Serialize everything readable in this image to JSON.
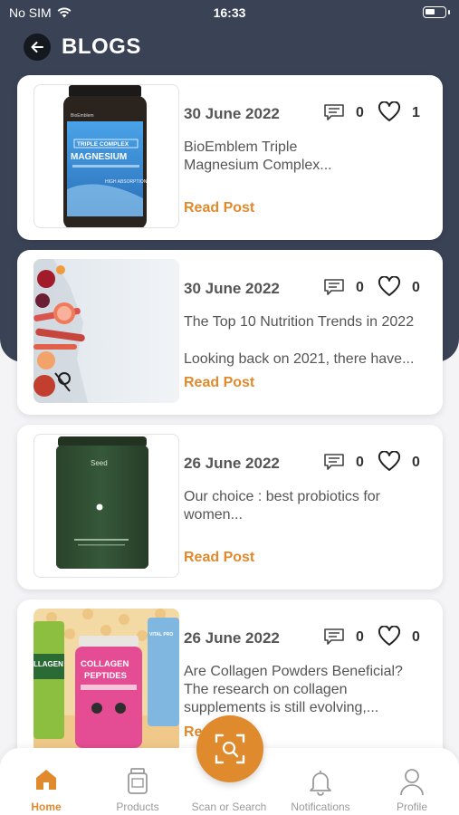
{
  "status_bar": {
    "carrier": "No SIM",
    "time": "16:33"
  },
  "header": {
    "title": "BLOGS"
  },
  "posts": [
    {
      "date": "30 June 2022",
      "comments": "0",
      "likes": "1",
      "title": "BioEmblem Triple Magnesium Complex...",
      "excerpt": "",
      "read_label": "Read Post",
      "thumb_text": {
        "brand": "BioEmblem",
        "line1": "TRIPLE COMPLEX",
        "line2": "MAGNESIUM",
        "line3": "HIGH ABSORPTION"
      }
    },
    {
      "date": "30 June 2022",
      "comments": "0",
      "likes": "0",
      "title": "The Top 10 Nutrition Trends in 2022",
      "excerpt": "Looking back on 2021, there have...",
      "read_label": "Read Post"
    },
    {
      "date": "26 June 2022",
      "comments": "0",
      "likes": "0",
      "title": "Our choice : best probiotics for women...",
      "excerpt": "",
      "read_label": "Read Post",
      "thumb_text": {
        "brand": "Seed"
      }
    },
    {
      "date": "26 June 2022",
      "comments": "0",
      "likes": "0",
      "title": "Are Collagen Powders Beneficial? The research on collagen supplements is still evolving,...",
      "excerpt": "",
      "read_label": "Read Post",
      "thumb_text": {
        "left": "LLAGEN",
        "center1": "COLLAGEN",
        "center2": "PEPTIDES",
        "right": "VITAL PRO"
      }
    }
  ],
  "tabbar": {
    "tabs": [
      {
        "label": "Home",
        "icon": "home-icon",
        "active": true
      },
      {
        "label": "Products",
        "icon": "jar-icon"
      },
      {
        "label": "Scan or Search",
        "icon": "scan-icon"
      },
      {
        "label": "Notifications",
        "icon": "bell-icon"
      },
      {
        "label": "Profile",
        "icon": "person-icon"
      }
    ]
  },
  "colors": {
    "header_bg": "#3a4256",
    "accent": "#e08a2e",
    "background": "#f4f4f6"
  }
}
